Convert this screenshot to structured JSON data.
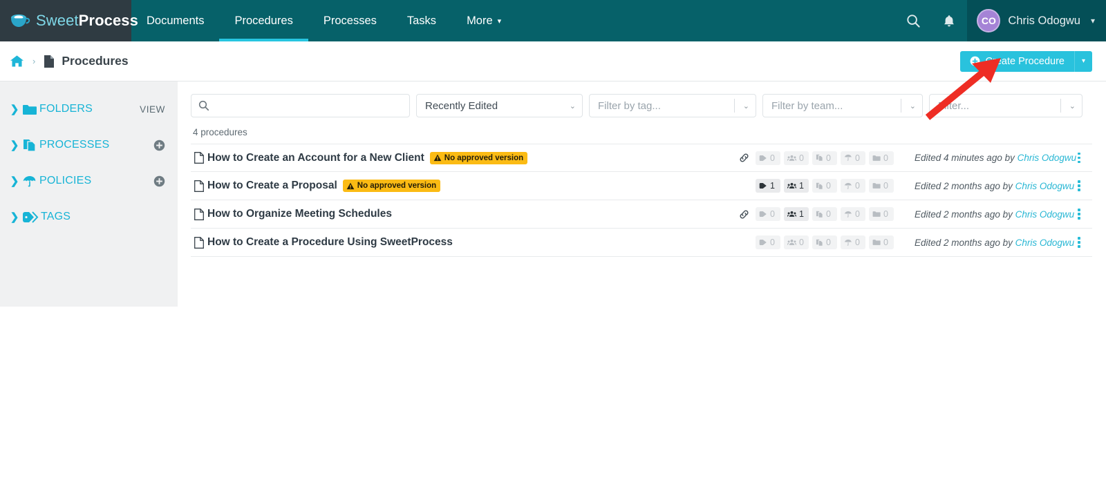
{
  "brand": {
    "name_light": "Sweet",
    "name_bold": "Process",
    "logo_icon": "coffee-cup-icon"
  },
  "topnav": {
    "items": [
      {
        "label": "Documents",
        "active": false
      },
      {
        "label": "Procedures",
        "active": true
      },
      {
        "label": "Processes",
        "active": false
      },
      {
        "label": "Tasks",
        "active": false
      },
      {
        "label": "More",
        "active": false,
        "caret": "▾"
      }
    ],
    "search_icon": "search-icon",
    "notifications_icon": "bell-icon",
    "user": {
      "initials": "CO",
      "name": "Chris Odogwu",
      "caret": "▾"
    }
  },
  "breadcrumb": {
    "home_icon": "home-icon",
    "separator": "›",
    "page_icon": "document-icon",
    "title": "Procedures"
  },
  "create_button": {
    "icon": "plus-circle-icon",
    "label": "Create Procedure",
    "caret": "▾"
  },
  "sidebar": {
    "items": [
      {
        "label": "FOLDERS",
        "icon": "folder-icon",
        "action_text": "VIEW",
        "action_icon": null
      },
      {
        "label": "PROCESSES",
        "icon": "processes-icon",
        "action_text": null,
        "action_icon": "plus-circle-icon"
      },
      {
        "label": "POLICIES",
        "icon": "umbrella-icon",
        "action_text": null,
        "action_icon": "plus-circle-icon"
      },
      {
        "label": "TAGS",
        "icon": "tag-icon",
        "action_text": null,
        "action_icon": null
      }
    ]
  },
  "filters": {
    "search": {
      "icon": "search-icon",
      "value": "",
      "placeholder": ""
    },
    "sort": {
      "value": "Recently Edited",
      "caret": "⌄"
    },
    "tag": {
      "placeholder": "Filter by tag...",
      "caret": "⌄"
    },
    "team": {
      "placeholder": "Filter by team...",
      "caret": "⌄"
    },
    "fourth": {
      "placeholder": "Filter...",
      "caret": "⌄"
    }
  },
  "result_count": "4 procedures",
  "list": {
    "rows": [
      {
        "icon": "document-icon",
        "title": "How to Create an Account for a New Client",
        "badge": {
          "icon": "warning-triangle-icon",
          "text": "No approved version"
        },
        "link_icon": "link-icon",
        "has_link": true,
        "chips": [
          {
            "icon": "tag-icon",
            "count": "0",
            "active": false
          },
          {
            "icon": "people-icon",
            "count": "0",
            "active": false
          },
          {
            "icon": "processes-icon",
            "count": "0",
            "active": false
          },
          {
            "icon": "umbrella-icon",
            "count": "0",
            "active": false
          },
          {
            "icon": "folder-icon",
            "count": "0",
            "active": false
          }
        ],
        "edited_prefix": "Edited 4 minutes ago by ",
        "edited_author": "Chris Odogwu",
        "menu_icon": "kebab-menu-icon"
      },
      {
        "icon": "document-icon",
        "title": "How to Create a Proposal",
        "badge": {
          "icon": "warning-triangle-icon",
          "text": "No approved version"
        },
        "link_icon": "link-icon",
        "has_link": false,
        "chips": [
          {
            "icon": "tag-icon",
            "count": "1",
            "active": true
          },
          {
            "icon": "people-icon",
            "count": "1",
            "active": true
          },
          {
            "icon": "processes-icon",
            "count": "0",
            "active": false
          },
          {
            "icon": "umbrella-icon",
            "count": "0",
            "active": false
          },
          {
            "icon": "folder-icon",
            "count": "0",
            "active": false
          }
        ],
        "edited_prefix": "Edited 2 months ago by ",
        "edited_author": "Chris Odogwu",
        "menu_icon": "kebab-menu-icon"
      },
      {
        "icon": "document-icon",
        "title": "How to Organize Meeting Schedules",
        "badge": null,
        "link_icon": "link-icon",
        "has_link": true,
        "chips": [
          {
            "icon": "tag-icon",
            "count": "0",
            "active": false
          },
          {
            "icon": "people-icon",
            "count": "1",
            "active": true
          },
          {
            "icon": "processes-icon",
            "count": "0",
            "active": false
          },
          {
            "icon": "umbrella-icon",
            "count": "0",
            "active": false
          },
          {
            "icon": "folder-icon",
            "count": "0",
            "active": false
          }
        ],
        "edited_prefix": "Edited 2 months ago by ",
        "edited_author": "Chris Odogwu",
        "menu_icon": "kebab-menu-icon"
      },
      {
        "icon": "document-icon",
        "title": "How to Create a Procedure Using SweetProcess",
        "badge": null,
        "link_icon": "link-icon",
        "has_link": false,
        "chips": [
          {
            "icon": "tag-icon",
            "count": "0",
            "active": false
          },
          {
            "icon": "people-icon",
            "count": "0",
            "active": false
          },
          {
            "icon": "processes-icon",
            "count": "0",
            "active": false
          },
          {
            "icon": "umbrella-icon",
            "count": "0",
            "active": false
          },
          {
            "icon": "folder-icon",
            "count": "0",
            "active": false
          }
        ],
        "edited_prefix": "Edited 2 months ago by ",
        "edited_author": "Chris Odogwu",
        "menu_icon": "kebab-menu-icon"
      }
    ]
  },
  "annotation": {
    "arrow_icon": "red-arrow-annotation",
    "color": "#ee2d24"
  },
  "colors": {
    "nav_bg": "#066169",
    "brand_bg": "#2f3b42",
    "accent_cyan": "#29c2dd",
    "sidebar_bg": "#f0f1f2",
    "badge_yellow": "#fbbb14",
    "avatar": "#a583d6"
  }
}
